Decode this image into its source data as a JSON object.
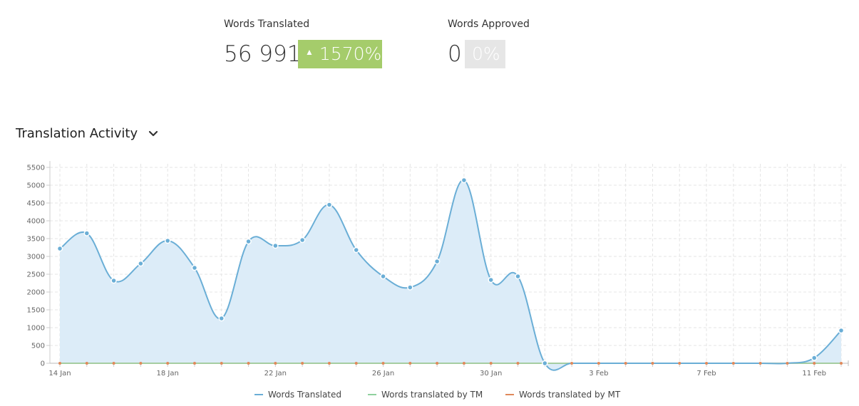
{
  "stats": {
    "translated": {
      "label": "Words Translated",
      "value": "56 991",
      "change": "1570%",
      "direction": "up",
      "color": "#a5cc6b"
    },
    "approved": {
      "label": "Words Approved",
      "value": "0",
      "change": "0%",
      "color": "#e6e6e6"
    }
  },
  "section": {
    "title": "Translation Activity"
  },
  "icons": {
    "dropdown": "chevron-down-icon",
    "change_up": "triangle-up-icon"
  },
  "chart_data": {
    "type": "area",
    "x": [
      "14 Jan",
      "15 Jan",
      "16 Jan",
      "17 Jan",
      "18 Jan",
      "19 Jan",
      "20 Jan",
      "21 Jan",
      "22 Jan",
      "23 Jan",
      "24 Jan",
      "25 Jan",
      "26 Jan",
      "27 Jan",
      "28 Jan",
      "29 Jan",
      "30 Jan",
      "31 Jan",
      "1 Feb",
      "2 Feb",
      "3 Feb",
      "4 Feb",
      "5 Feb",
      "6 Feb",
      "7 Feb",
      "8 Feb",
      "9 Feb",
      "10 Feb",
      "11 Feb",
      "12 Feb"
    ],
    "xtick_labels": [
      "14 Jan",
      "18 Jan",
      "22 Jan",
      "26 Jan",
      "30 Jan",
      "3 Feb",
      "7 Feb",
      "11 Feb"
    ],
    "yticks": [
      0,
      500,
      1000,
      1500,
      2000,
      2500,
      3000,
      3500,
      4000,
      4500,
      5000,
      5500
    ],
    "ylim": [
      0,
      5600
    ],
    "grid": true,
    "legend_position": "bottom",
    "series": [
      {
        "name": "Words Translated",
        "color": "#6aaed6",
        "fill": "#dcecf8",
        "values": [
          3220,
          3650,
          2320,
          2800,
          3440,
          2680,
          1260,
          3420,
          3300,
          3460,
          4450,
          3180,
          2440,
          2130,
          2860,
          5140,
          2340,
          2440,
          0,
          0,
          0,
          0,
          0,
          0,
          0,
          0,
          0,
          0,
          150,
          920
        ]
      },
      {
        "name": "Words translated by TM",
        "color": "#8fd19e",
        "values": [
          0,
          0,
          0,
          0,
          0,
          0,
          0,
          0,
          0,
          0,
          0,
          0,
          0,
          0,
          0,
          0,
          0,
          0,
          0,
          0,
          0,
          0,
          0,
          0,
          0,
          0,
          0,
          0,
          0,
          0
        ]
      },
      {
        "name": "Words translated by MT",
        "color": "#e0895a",
        "values": [
          0,
          0,
          0,
          0,
          0,
          0,
          0,
          0,
          0,
          0,
          0,
          0,
          0,
          0,
          0,
          0,
          0,
          0,
          0,
          0,
          0,
          0,
          0,
          0,
          0,
          0,
          0,
          0,
          0,
          0
        ]
      }
    ]
  }
}
